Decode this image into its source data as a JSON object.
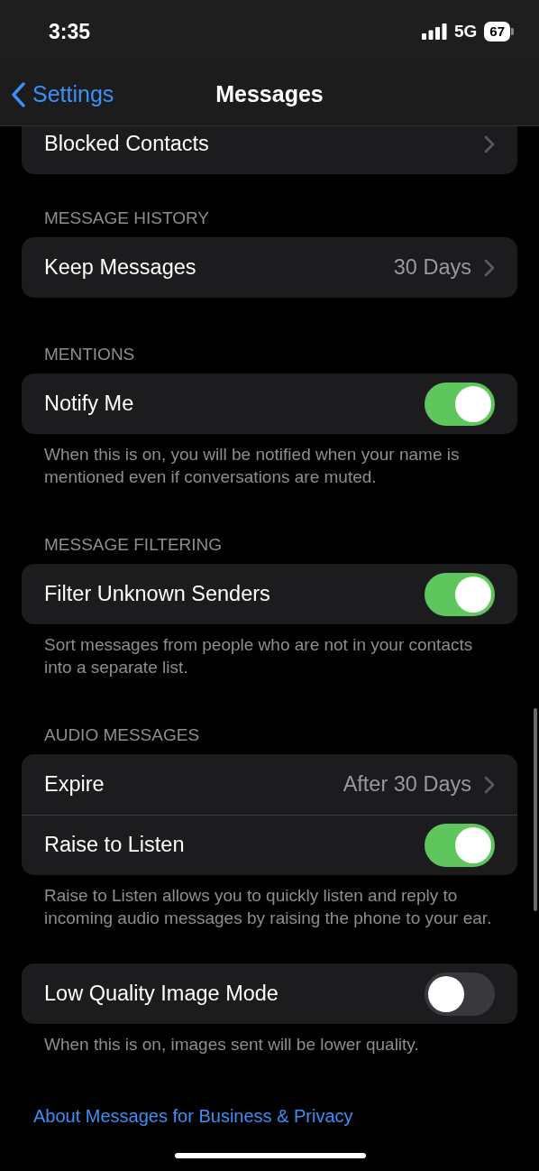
{
  "status_bar": {
    "time": "3:35",
    "network": "5G",
    "battery": "67"
  },
  "nav": {
    "back": "Settings",
    "title": "Messages"
  },
  "sections": [
    {
      "rows": [
        {
          "kind": "link",
          "label": "Blocked Contacts"
        }
      ]
    },
    {
      "header": "MESSAGE HISTORY",
      "rows": [
        {
          "kind": "link",
          "label": "Keep Messages",
          "value": "30 Days"
        }
      ]
    },
    {
      "header": "MENTIONS",
      "rows": [
        {
          "kind": "toggle",
          "label": "Notify Me",
          "on": true
        }
      ],
      "footer": "When this is on, you will be notified when your name is mentioned even if conversations are muted."
    },
    {
      "header": "MESSAGE FILTERING",
      "rows": [
        {
          "kind": "toggle",
          "label": "Filter Unknown Senders",
          "on": true
        }
      ],
      "footer": "Sort messages from people who are not in your contacts into a separate list."
    },
    {
      "header": "AUDIO MESSAGES",
      "rows": [
        {
          "kind": "link",
          "label": "Expire",
          "value": "After 30 Days"
        },
        {
          "kind": "toggle",
          "label": "Raise to Listen",
          "on": true
        }
      ],
      "footer": "Raise to Listen allows you to quickly listen and reply to incoming audio messages by raising the phone to your ear."
    },
    {
      "rows": [
        {
          "kind": "toggle",
          "label": "Low Quality Image Mode",
          "on": false
        }
      ],
      "footer": "When this is on, images sent will be lower quality."
    }
  ],
  "about_link": "About Messages for Business & Privacy"
}
